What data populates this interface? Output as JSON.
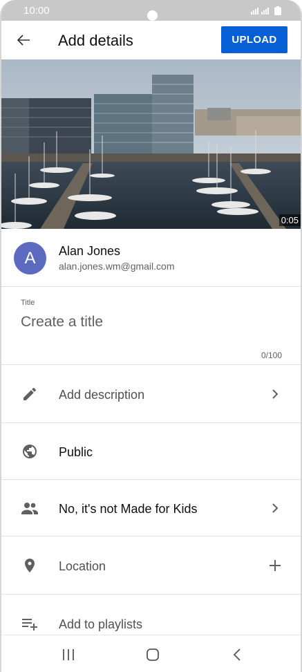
{
  "status_bar": {
    "time": "10:00",
    "signal_icon": "signal-icon",
    "battery_icon": "battery-icon"
  },
  "app_bar": {
    "back_icon": "arrow-back-icon",
    "title": "Add details",
    "upload_label": "UPLOAD",
    "upload_color": "#065fd4"
  },
  "video": {
    "duration": "0:05"
  },
  "account": {
    "avatar_letter": "A",
    "avatar_color": "#5c6bc0",
    "name": "Alan Jones",
    "email": "alan.jones.wm@gmail.com"
  },
  "title_field": {
    "label": "Title",
    "placeholder": "Create a title",
    "value": "",
    "counter": "0/100"
  },
  "rows": [
    {
      "icon": "pencil-icon",
      "label": "Add description",
      "trailing": "chevron-right-icon"
    },
    {
      "icon": "globe-icon",
      "label": "Public",
      "trailing": ""
    },
    {
      "icon": "people-icon",
      "label": "No, it's not Made for Kids",
      "trailing": "chevron-right-icon"
    },
    {
      "icon": "location-pin-icon",
      "label": "Location",
      "trailing": "plus-icon"
    },
    {
      "icon": "playlist-add-icon",
      "label": "Add to playlists",
      "trailing": ""
    }
  ],
  "nav_bar": {
    "recents_icon": "recents-icon",
    "home_icon": "home-icon",
    "back_icon": "nav-back-icon"
  }
}
